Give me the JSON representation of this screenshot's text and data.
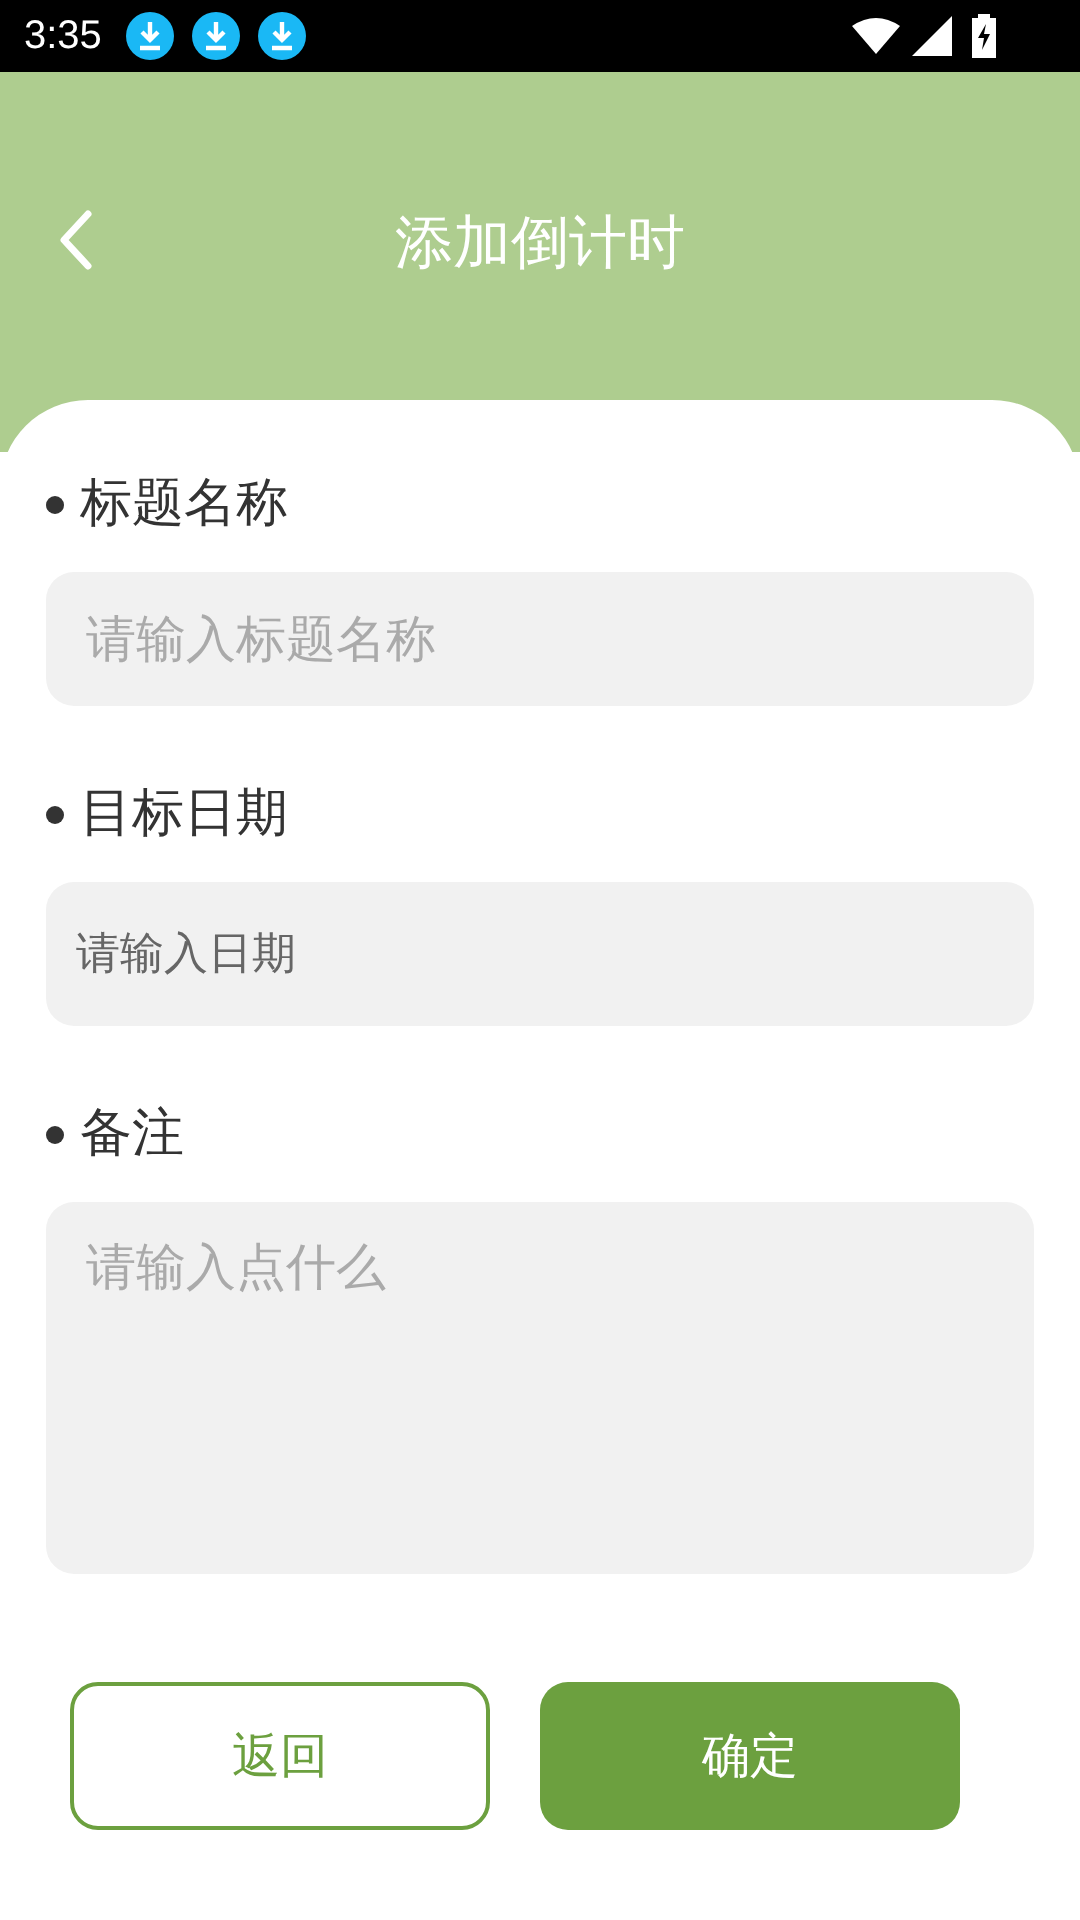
{
  "status_bar": {
    "time": "3:35"
  },
  "header": {
    "title": "添加倒计时"
  },
  "fields": [
    {
      "label": "标题名称",
      "placeholder": "请输入标题名称",
      "kind": "input"
    },
    {
      "label": "目标日期",
      "placeholder": "请输入日期",
      "kind": "date"
    },
    {
      "label": "备注",
      "placeholder": "请输入点什么",
      "kind": "textarea"
    }
  ],
  "buttons": [
    {
      "label": "返回",
      "kind": "secondary"
    },
    {
      "label": "确定",
      "kind": "primary"
    }
  ]
}
